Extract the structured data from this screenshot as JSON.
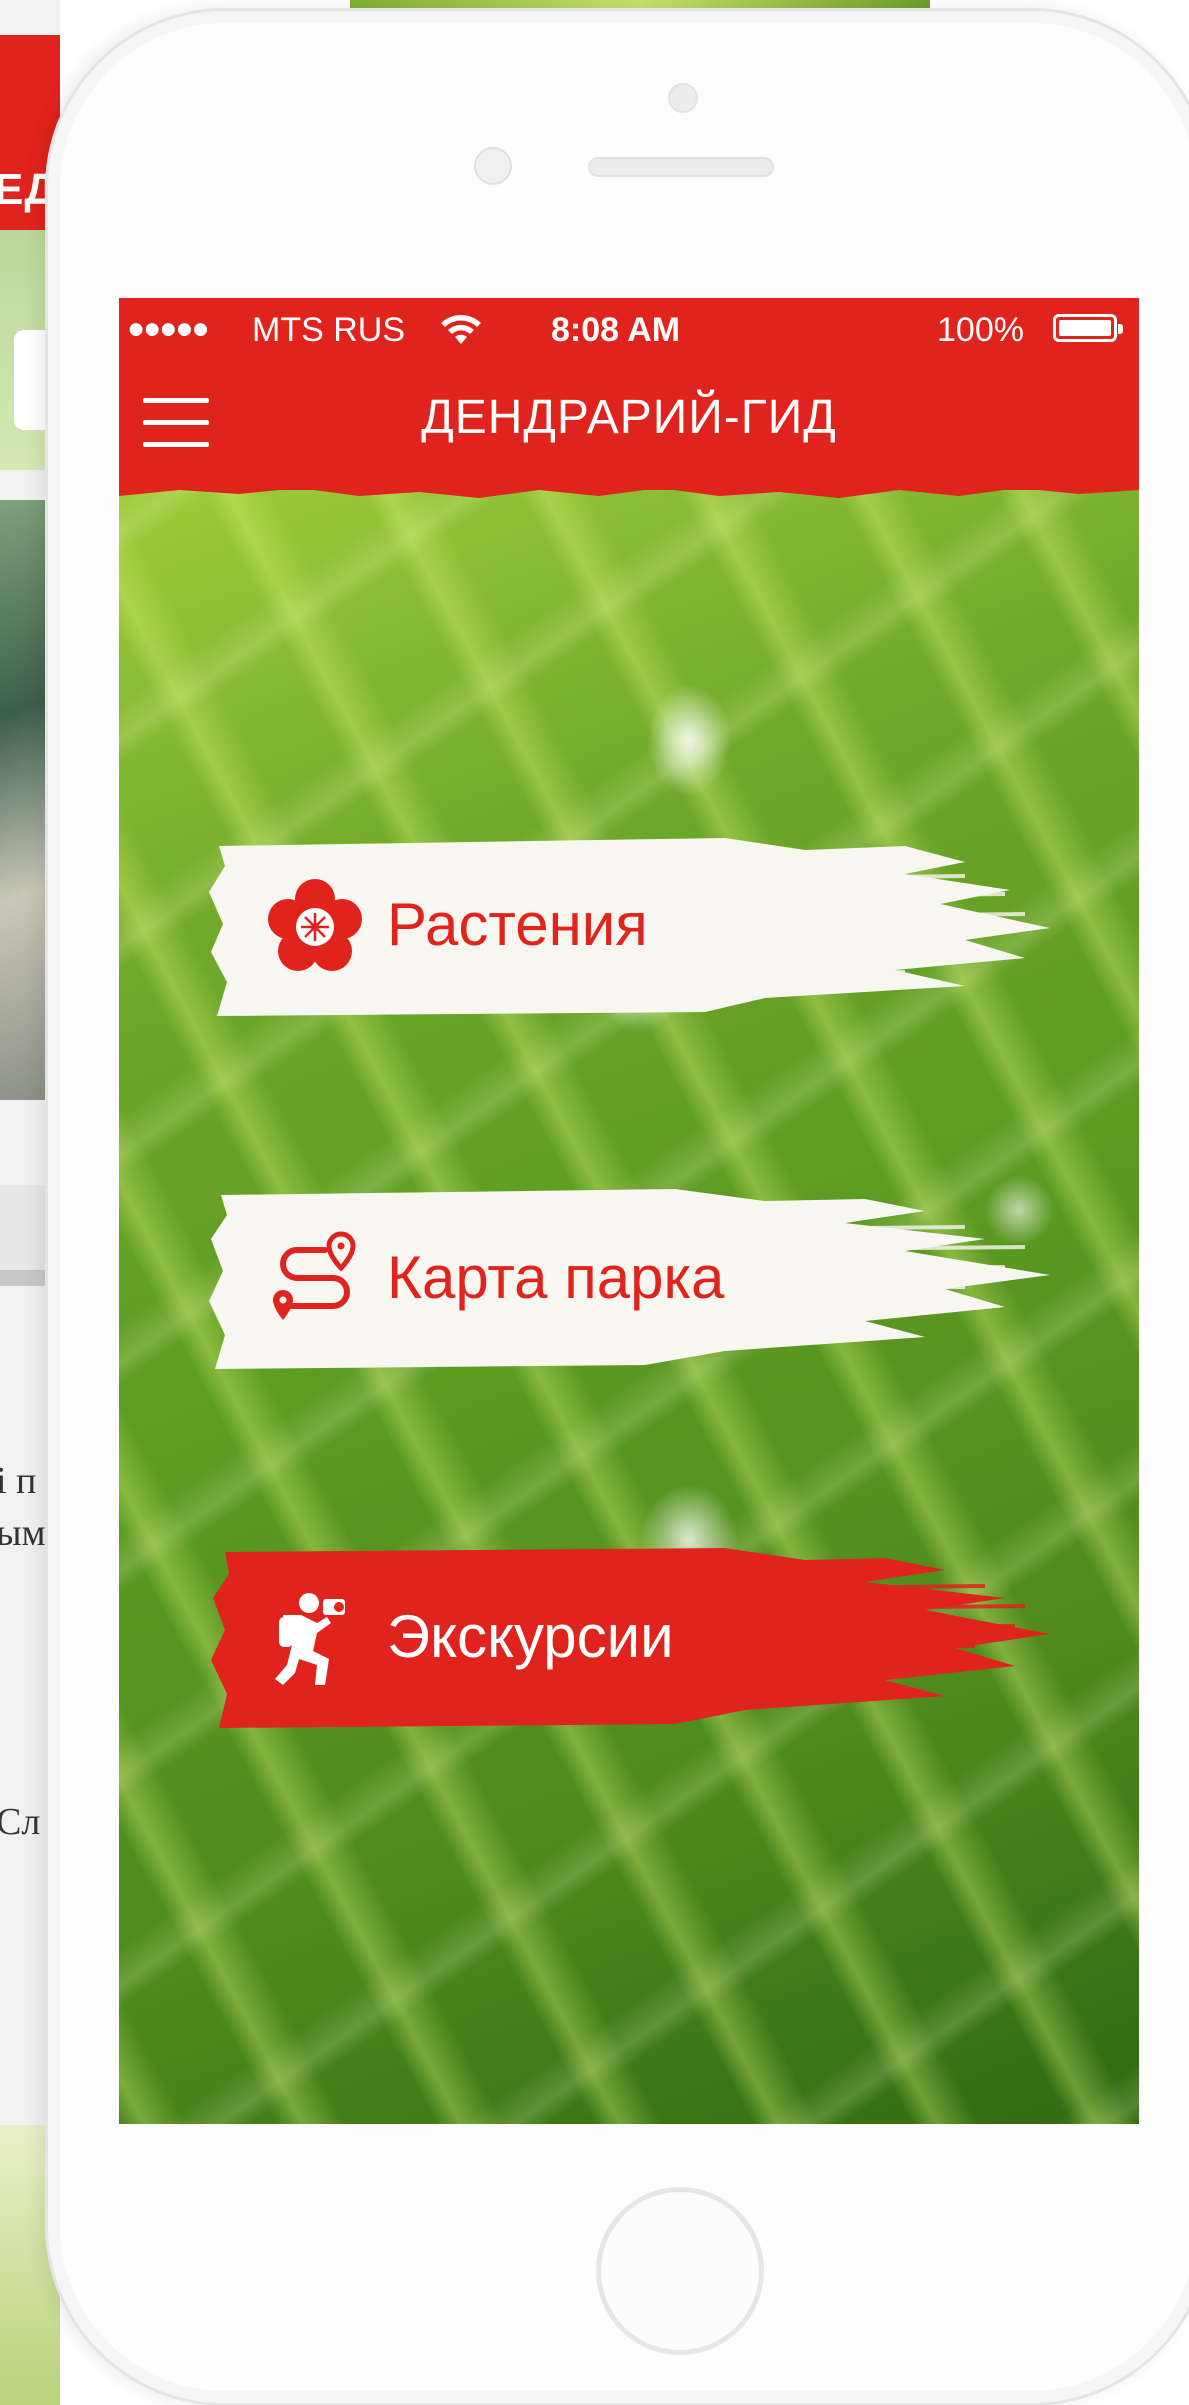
{
  "background_app": {
    "header_fragment": "ЕД",
    "text_fragment_1": "і п",
    "text_fragment_2": "ым",
    "text_fragment_3": "Сл"
  },
  "status_bar": {
    "signal": "●●●●●",
    "carrier": "MTS RUS",
    "time": "8:08 AM",
    "battery": "100%"
  },
  "nav": {
    "title": "ДЕНДРАРИЙ-ГИД"
  },
  "menu": {
    "plants_label": "Растения",
    "map_label": "Карта парка",
    "tours_label": "Экскурсии"
  },
  "colors": {
    "accent": "#e0231c",
    "brush_light": "#f7f6f1"
  }
}
